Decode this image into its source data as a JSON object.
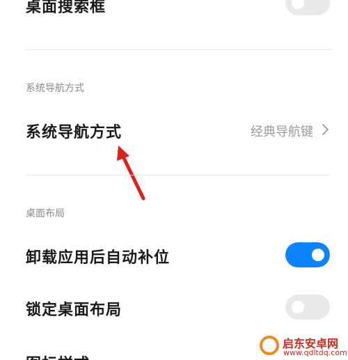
{
  "settings": {
    "desktop_search_box": {
      "title": "桌面搜索框",
      "enabled": false
    },
    "nav_section_header": "系统导航方式",
    "nav_mode": {
      "title": "系统导航方式",
      "value": "经典导航键"
    },
    "layout_section_header": "桌面布局",
    "auto_fill": {
      "title": "卸载应用后自动补位",
      "enabled": true
    },
    "lock_layout": {
      "title": "锁定桌面布局",
      "enabled": false
    },
    "icon_style": {
      "title": "图标样式"
    }
  },
  "colors": {
    "toggle_on": "#0d84ff",
    "toggle_off": "#e9e9eb",
    "annotation_arrow": "#e0201a"
  },
  "icons": {
    "nav_chevron": "chevron-right-icon",
    "annotation": "red-arrow-icon"
  },
  "watermark": {
    "name": "启东安卓网",
    "url": "www.qdltdq.com"
  }
}
